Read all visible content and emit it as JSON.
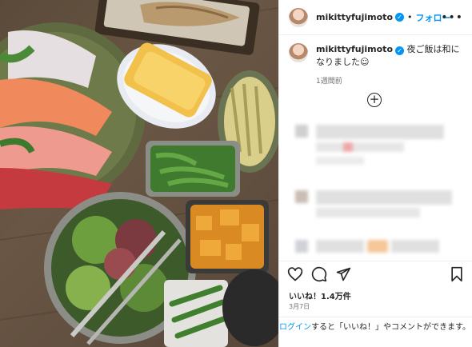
{
  "post": {
    "username": "mikittyfujimoto",
    "verified_icon": "verified-badge-icon",
    "separator": "•",
    "follow_label": "フォロー",
    "more_icon": "more-options-icon",
    "more_glyph": "•••",
    "caption_text": "夜ご飯は和になりました☺︎",
    "caption_time": "1週間前",
    "add_comment_glyph": "+",
    "likes": "いいね！1.4万件",
    "date": "3月7日",
    "login_link": "ログイン",
    "login_rest": "すると「いいね！」やコメントができます。"
  },
  "colors": {
    "accent": "#0095f6",
    "text": "#262626",
    "muted": "#737373"
  }
}
